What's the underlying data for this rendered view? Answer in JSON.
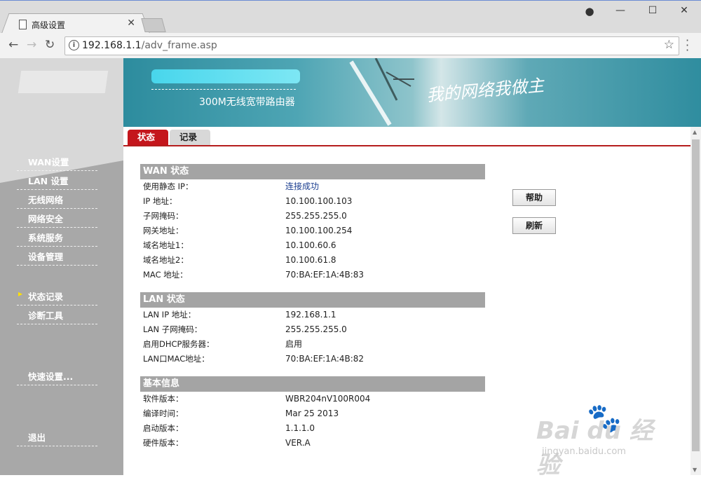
{
  "browser": {
    "tab_title": "高级设置",
    "url_host": "192.168.1.1",
    "url_path": "/adv_frame.asp"
  },
  "banner": {
    "subtitle": "300M无线宽带路由器",
    "slogan": "我的网络我做主"
  },
  "sidebar": {
    "items": [
      {
        "label": "WAN设置"
      },
      {
        "label": "LAN 设置"
      },
      {
        "label": "无线网络"
      },
      {
        "label": "网络安全"
      },
      {
        "label": "系统服务"
      },
      {
        "label": "设备管理"
      },
      {
        "label": "状态记录"
      },
      {
        "label": "诊断工具"
      },
      {
        "label": "快速设置..."
      },
      {
        "label": "退出"
      }
    ],
    "active_index": 6
  },
  "content_tabs": [
    "状态",
    "记录"
  ],
  "wan": {
    "title": "WAN 状态",
    "rows": [
      {
        "label": "使用静态 IP：",
        "value": "连接成功"
      },
      {
        "label": "IP 地址：",
        "value": "10.100.100.103"
      },
      {
        "label": "子网掩码：",
        "value": "255.255.255.0"
      },
      {
        "label": "网关地址：",
        "value": "10.100.100.254"
      },
      {
        "label": "域名地址1：",
        "value": "10.100.60.6"
      },
      {
        "label": "域名地址2：",
        "value": "10.100.61.8"
      },
      {
        "label": "MAC 地址：",
        "value": "70:BA:EF:1A:4B:83"
      }
    ]
  },
  "lan": {
    "title": "LAN 状态",
    "rows": [
      {
        "label": "LAN IP 地址：",
        "value": "192.168.1.1"
      },
      {
        "label": "LAN 子网掩码：",
        "value": "255.255.255.0"
      },
      {
        "label": "启用DHCP服务器：",
        "value": "启用"
      },
      {
        "label": "LAN口MAC地址：",
        "value": "70:BA:EF:1A:4B:82"
      }
    ]
  },
  "info": {
    "title": "基本信息",
    "rows": [
      {
        "label": "软件版本：",
        "value": "WBR204nV100R004"
      },
      {
        "label": "编译时间：",
        "value": "Mar 25 2013"
      },
      {
        "label": "启动版本：",
        "value": "1.1.1.0"
      },
      {
        "label": "硬件版本：",
        "value": "VER.A"
      }
    ]
  },
  "buttons": {
    "help": "帮助",
    "refresh": "刷新"
  },
  "watermark": {
    "main": "Bai  du 经验",
    "sub": "jingyan.baidu.com"
  },
  "colors": {
    "accent_red": "#c4161c",
    "sidebar_gray": "#a8a8a8",
    "banner_teal": "#2d8c9e"
  }
}
